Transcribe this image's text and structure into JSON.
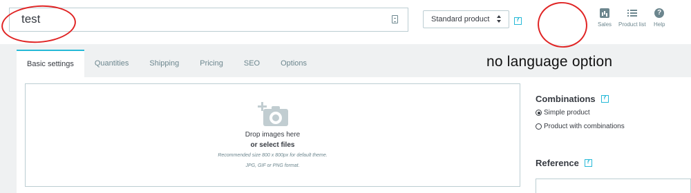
{
  "header": {
    "product_name_value": "test",
    "product_type_selected": "Standard product",
    "toolbar": [
      {
        "label": "Sales",
        "icon": "bar-chart-icon"
      },
      {
        "label": "Product list",
        "icon": "list-icon"
      },
      {
        "label": "Help",
        "icon": "help-circle-icon"
      }
    ]
  },
  "tabs": [
    "Basic settings",
    "Quantities",
    "Shipping",
    "Pricing",
    "SEO",
    "Options"
  ],
  "active_tab": "Basic settings",
  "annotation": "no language option",
  "dropzone": {
    "drop_text": "Drop images here",
    "select_text": "or select files",
    "size_hint": "Recommended size 800 x 800px for default theme.",
    "format_hint": "JPG, GIF or PNG format."
  },
  "combinations": {
    "title": "Combinations",
    "options": [
      {
        "label": "Simple product",
        "checked": true
      },
      {
        "label": "Product with combinations",
        "checked": false
      }
    ]
  },
  "reference": {
    "title": "Reference"
  },
  "colors": {
    "accent": "#25b9d7",
    "text": "#363a41",
    "muted": "#6c868e",
    "annotation_circle": "#e02424",
    "band": "#eff1f2"
  }
}
